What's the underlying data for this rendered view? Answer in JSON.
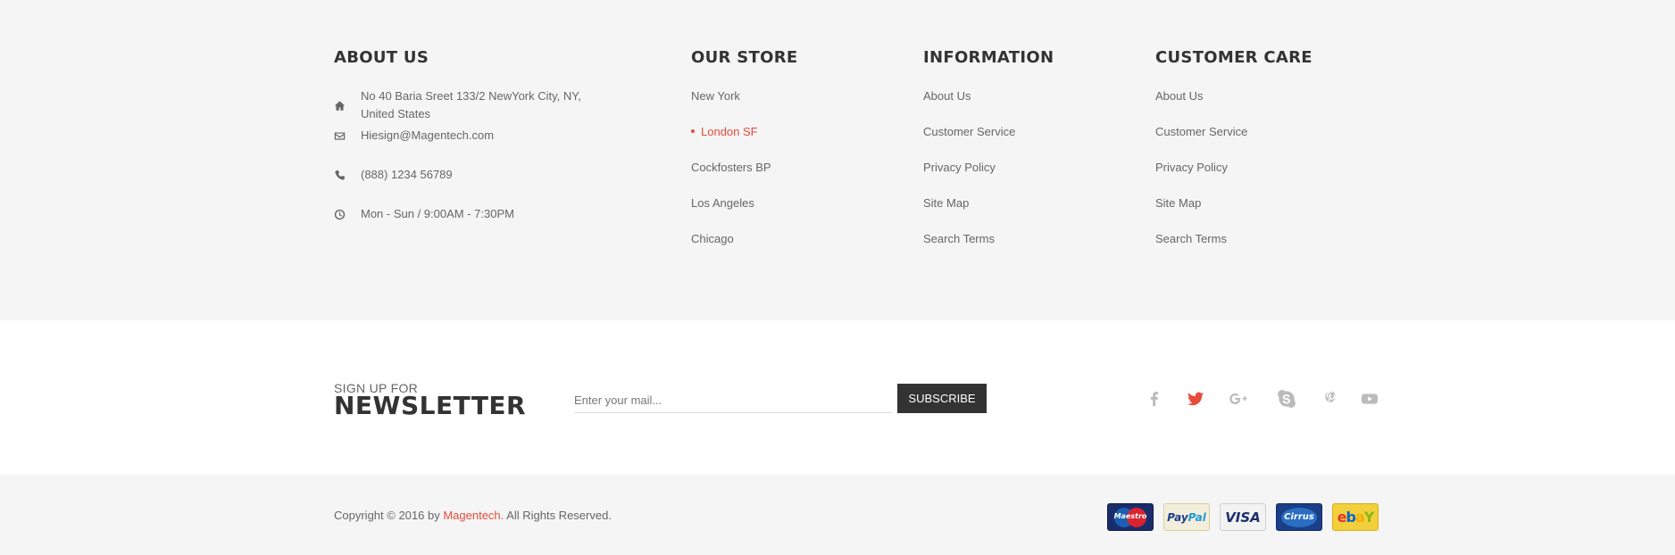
{
  "about": {
    "title": "ABOUT US",
    "address": "No 40 Baria Sreet 133/2 NewYork City, NY, United States",
    "email": "Hiesign@Magentech.com",
    "phone": "(888) 1234 56789",
    "hours": "Mon - Sun / 9:00AM - 7:30PM",
    "icons": [
      "home-icon",
      "envelope-icon",
      "phone-icon",
      "clock-icon"
    ]
  },
  "store": {
    "title": "OUR STORE",
    "items": [
      "New York",
      "London SF",
      "Cockfosters BP",
      "Los Angeles",
      "Chicago"
    ],
    "active_item": "London SF"
  },
  "information": {
    "title": "INFORMATION",
    "items": [
      "About Us",
      "Customer Service",
      "Privacy Policy",
      "Site Map",
      "Search Terms"
    ]
  },
  "customer_care": {
    "title": "CUSTOMER CARE",
    "items": [
      "About Us",
      "Customer Service",
      "Privacy Policy",
      "Site Map",
      "Search Terms"
    ]
  },
  "newsletter": {
    "small_label": "SIGN UP FOR",
    "big_label": "NEWSLETTER",
    "placeholder": "Enter your mail...",
    "button_label": "SUBSCRIBE"
  },
  "social": {
    "icons": [
      "facebook-icon",
      "twitter-icon",
      "google-plus-icon",
      "skype-icon",
      "pinterest-icon",
      "youtube-icon"
    ],
    "active": "twitter-icon"
  },
  "copyright": {
    "prefix": "Copyright © 2016 by ",
    "brand": "Magentech.",
    "suffix": " All Rights Reserved."
  },
  "payments": {
    "maestro": "Maestro",
    "paypal_a": "Pay",
    "paypal_b": "Pal",
    "visa": "VISA",
    "cirrus": "Cirrus",
    "ebay_e": "e",
    "ebay_b": "b",
    "ebay_a": "a",
    "ebay_y": "Y"
  },
  "colors": {
    "accent": "#e74c3c",
    "heading": "#333333",
    "text": "#666666",
    "footer_bg": "#f5f5f5"
  }
}
